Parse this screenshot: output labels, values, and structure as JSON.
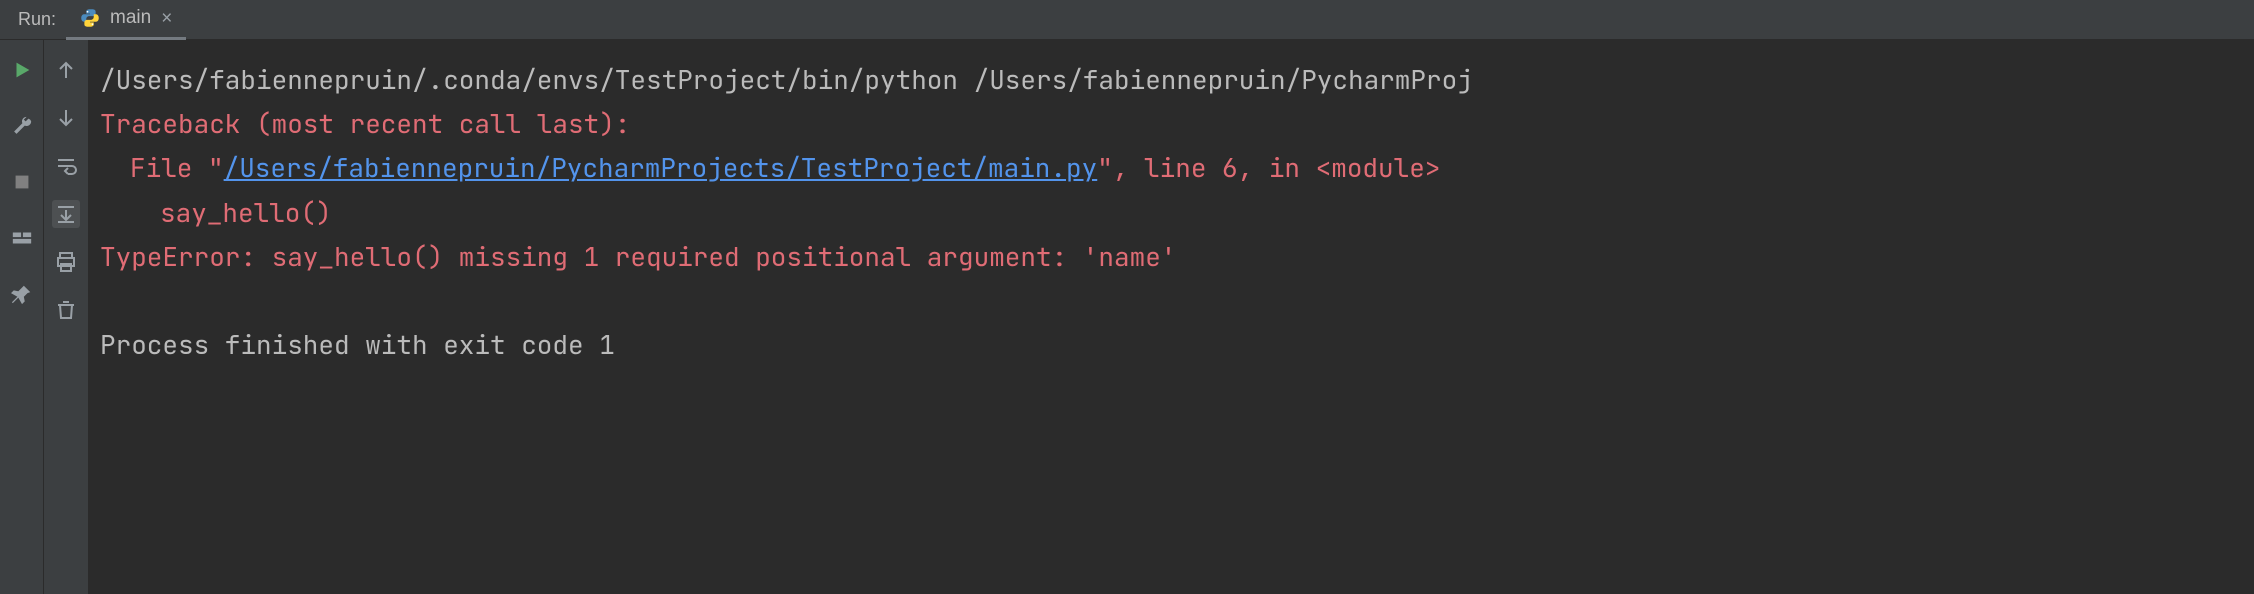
{
  "tab_bar": {
    "label": "Run:",
    "tab": {
      "icon": "python-file-icon",
      "label": "main",
      "close": "×"
    }
  },
  "console": {
    "command": "/Users/fabiennepruin/.conda/envs/TestProject/bin/python /Users/fabiennepruin/PycharmProj",
    "traceback_header": "Traceback (most recent call last):",
    "file_line_prefix": "File \"",
    "file_link": "/Users/fabiennepruin/PycharmProjects/TestProject/main.py",
    "file_line_suffix": "\", line 6, in <module>",
    "call_line": "say_hello()",
    "error_line": "TypeError: say_hello() missing 1 required positional argument: 'name'",
    "blank": "",
    "exit_line": "Process finished with exit code 1"
  }
}
